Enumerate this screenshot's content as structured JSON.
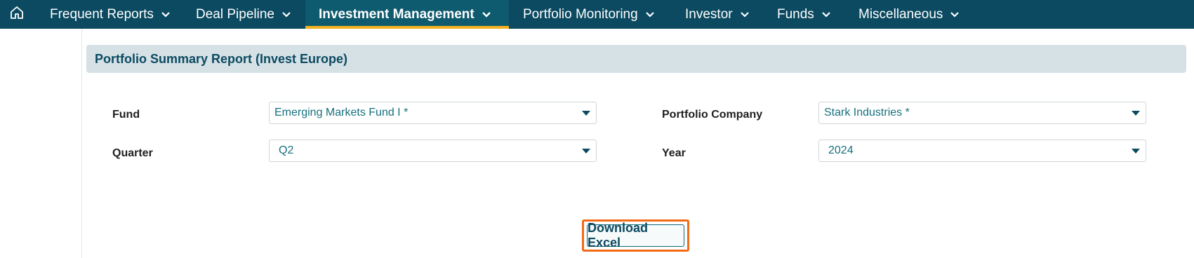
{
  "nav": {
    "items": [
      {
        "label": "Frequent Reports"
      },
      {
        "label": "Deal Pipeline"
      },
      {
        "label": "Investment Management"
      },
      {
        "label": "Portfolio Monitoring"
      },
      {
        "label": "Investor"
      },
      {
        "label": "Funds"
      },
      {
        "label": "Miscellaneous"
      }
    ],
    "active_item": "Investment Management"
  },
  "report": {
    "title": "Portfolio Summary Report (Invest Europe)"
  },
  "form": {
    "fund": {
      "label": "Fund",
      "value": "Emerging Markets Fund I *"
    },
    "portfolio_company": {
      "label": "Portfolio Company",
      "value": "Stark Industries *"
    },
    "quarter": {
      "label": "Quarter",
      "value": "Q2"
    },
    "year": {
      "label": "Year",
      "value": "2024"
    }
  },
  "actions": {
    "download_label": "Download Excel"
  },
  "colors": {
    "nav_bg": "#0b4a61",
    "active_underline": "#f2b01e",
    "header_bg": "#d6e1e6",
    "highlight_border": "#f26b17",
    "value_text": "#16707f"
  }
}
